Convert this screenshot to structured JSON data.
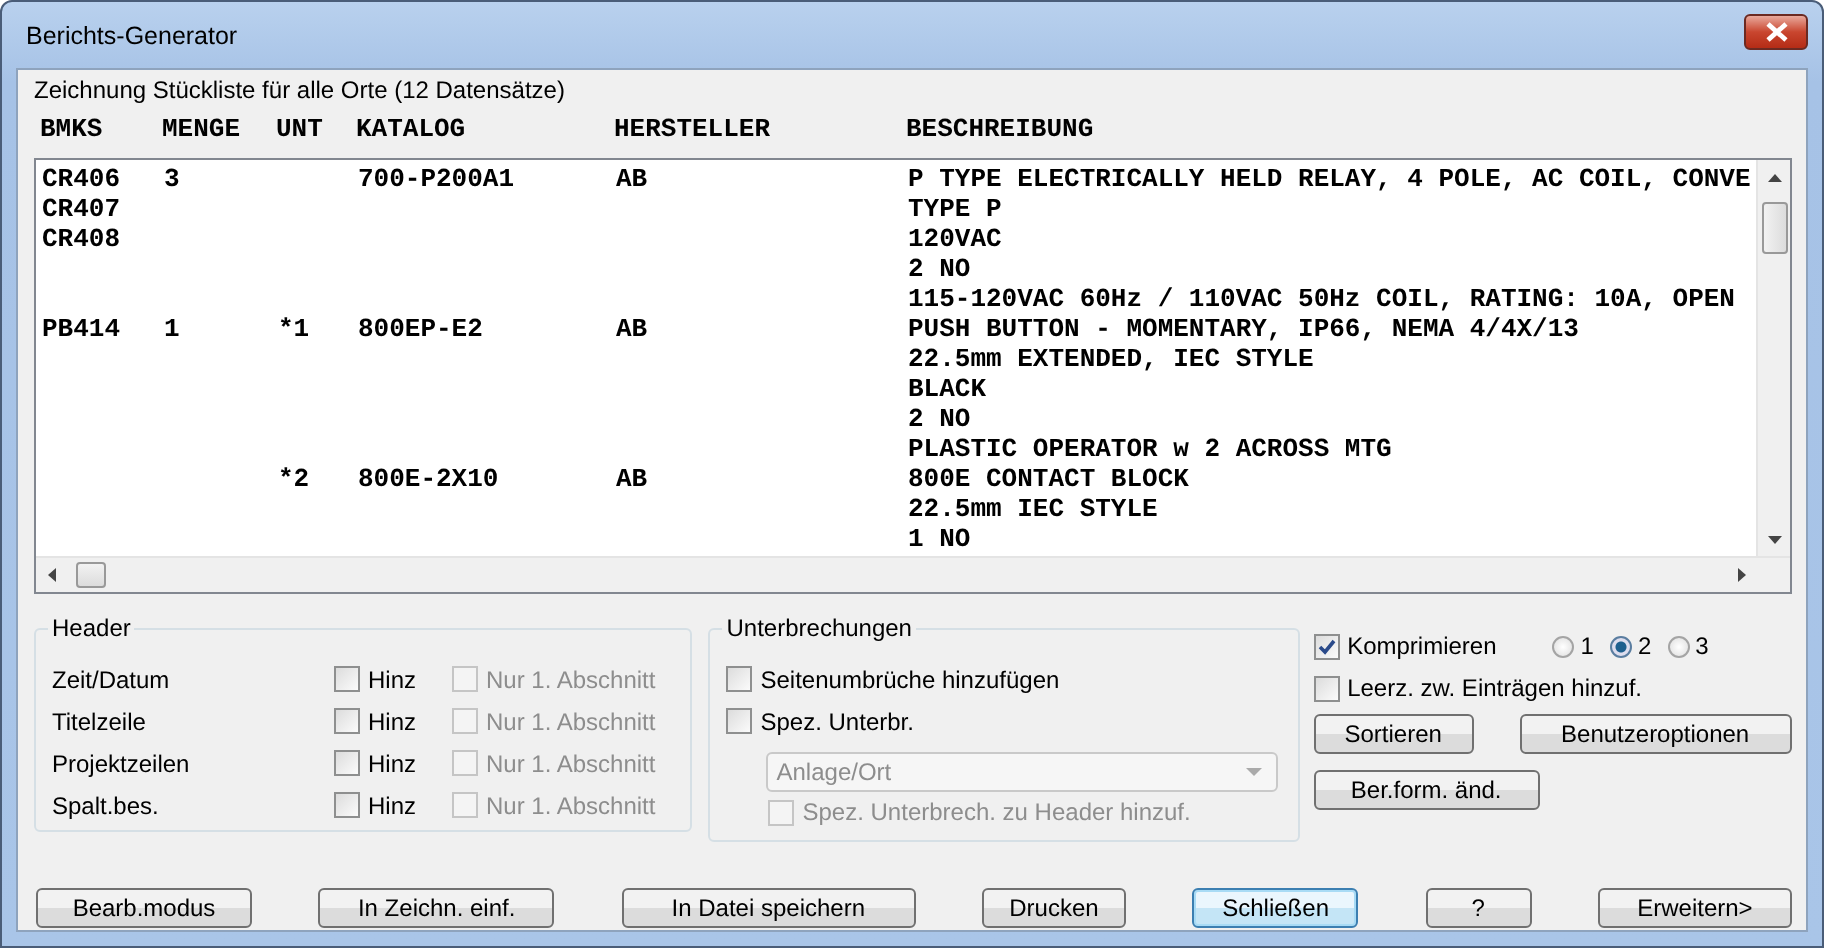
{
  "window": {
    "title": "Berichts-Generator"
  },
  "report": {
    "caption": "Zeichnung Stückliste für alle Orte (12 Datensätze)",
    "columns": [
      "BMKS",
      "MENGE",
      "UNT",
      "KATALOG",
      "HERSTELLER",
      "BESCHREIBUNG"
    ],
    "lines": [
      {
        "bmks": "CR406",
        "menge": "3",
        "katalog": "700-P200A1",
        "hersteller": "AB",
        "beschreibung": "P TYPE ELECTRICALLY HELD RELAY, 4 POLE, AC COIL, CONVE"
      },
      {
        "bmks": "CR407",
        "beschreibung": "TYPE P"
      },
      {
        "bmks": "CR408",
        "beschreibung": "120VAC"
      },
      {
        "beschreibung": "2 NO"
      },
      {
        "beschreibung": "115-120VAC 60Hz / 110VAC 50Hz COIL, RATING: 10A, OPEN"
      },
      {
        "bmks": "PB414",
        "menge": "1",
        "unt": "*1",
        "katalog": "800EP-E2",
        "hersteller": "AB",
        "beschreibung": "PUSH BUTTON - MOMENTARY, IP66, NEMA 4/4X/13"
      },
      {
        "beschreibung": "22.5mm EXTENDED, IEC STYLE"
      },
      {
        "beschreibung": "BLACK"
      },
      {
        "beschreibung": "2 NO"
      },
      {
        "beschreibung": "PLASTIC OPERATOR w 2 ACROSS MTG"
      },
      {
        "unt": "*2",
        "katalog": "800E-2X10",
        "hersteller": "AB",
        "beschreibung": "800E CONTACT BLOCK"
      },
      {
        "beschreibung": "22.5mm IEC STYLE"
      },
      {
        "beschreibung": "1 NO"
      }
    ]
  },
  "header_options": {
    "title": "Header",
    "rows": [
      {
        "label": "Zeit/Datum",
        "hinz": {
          "label": "Hinz",
          "checked": false
        },
        "nur": {
          "label": "Nur 1. Abschnitt",
          "checked": false,
          "disabled": true
        }
      },
      {
        "label": "Titelzeile",
        "hinz": {
          "label": "Hinz",
          "checked": false
        },
        "nur": {
          "label": "Nur 1. Abschnitt",
          "checked": false,
          "disabled": true
        }
      },
      {
        "label": "Projektzeilen",
        "hinz": {
          "label": "Hinz",
          "checked": false
        },
        "nur": {
          "label": "Nur 1. Abschnitt",
          "checked": false,
          "disabled": true
        }
      },
      {
        "label": "Spalt.bes.",
        "hinz": {
          "label": "Hinz",
          "checked": false
        },
        "nur": {
          "label": "Nur 1. Abschnitt",
          "checked": false,
          "disabled": true
        }
      }
    ]
  },
  "breaks": {
    "title": "Unterbrechungen",
    "options": [
      {
        "label": "Seitenumbrüche hinzufügen",
        "checked": false
      },
      {
        "label": "Spez. Unterbr.",
        "checked": false
      }
    ],
    "dropdown": {
      "value": "Anlage/Ort",
      "disabled": true
    },
    "header_option": {
      "label": "Spez. Unterbrech. zu Header hinzuf.",
      "checked": false,
      "disabled": true
    }
  },
  "compress": {
    "label": "Komprimieren",
    "checked": true,
    "levels": [
      {
        "label": "1",
        "selected": false
      },
      {
        "label": "2",
        "selected": true
      },
      {
        "label": "3",
        "selected": false
      }
    ]
  },
  "blank_lines": {
    "label": "Leerz. zw. Einträgen hinzuf.",
    "checked": false
  },
  "side_buttons": [
    "Sortieren",
    "Benutzeroptionen",
    "Ber.form. änd."
  ],
  "bottom_buttons": [
    {
      "label": "Bearb.modus",
      "default": false
    },
    {
      "label": "In Zeichn. einf.",
      "default": false
    },
    {
      "label": "In Datei speichern",
      "default": false
    },
    {
      "label": "Drucken",
      "default": false
    },
    {
      "label": "Schließen",
      "default": true
    },
    {
      "label": "?",
      "default": false
    },
    {
      "label": "Erweitern>",
      "default": false
    }
  ]
}
